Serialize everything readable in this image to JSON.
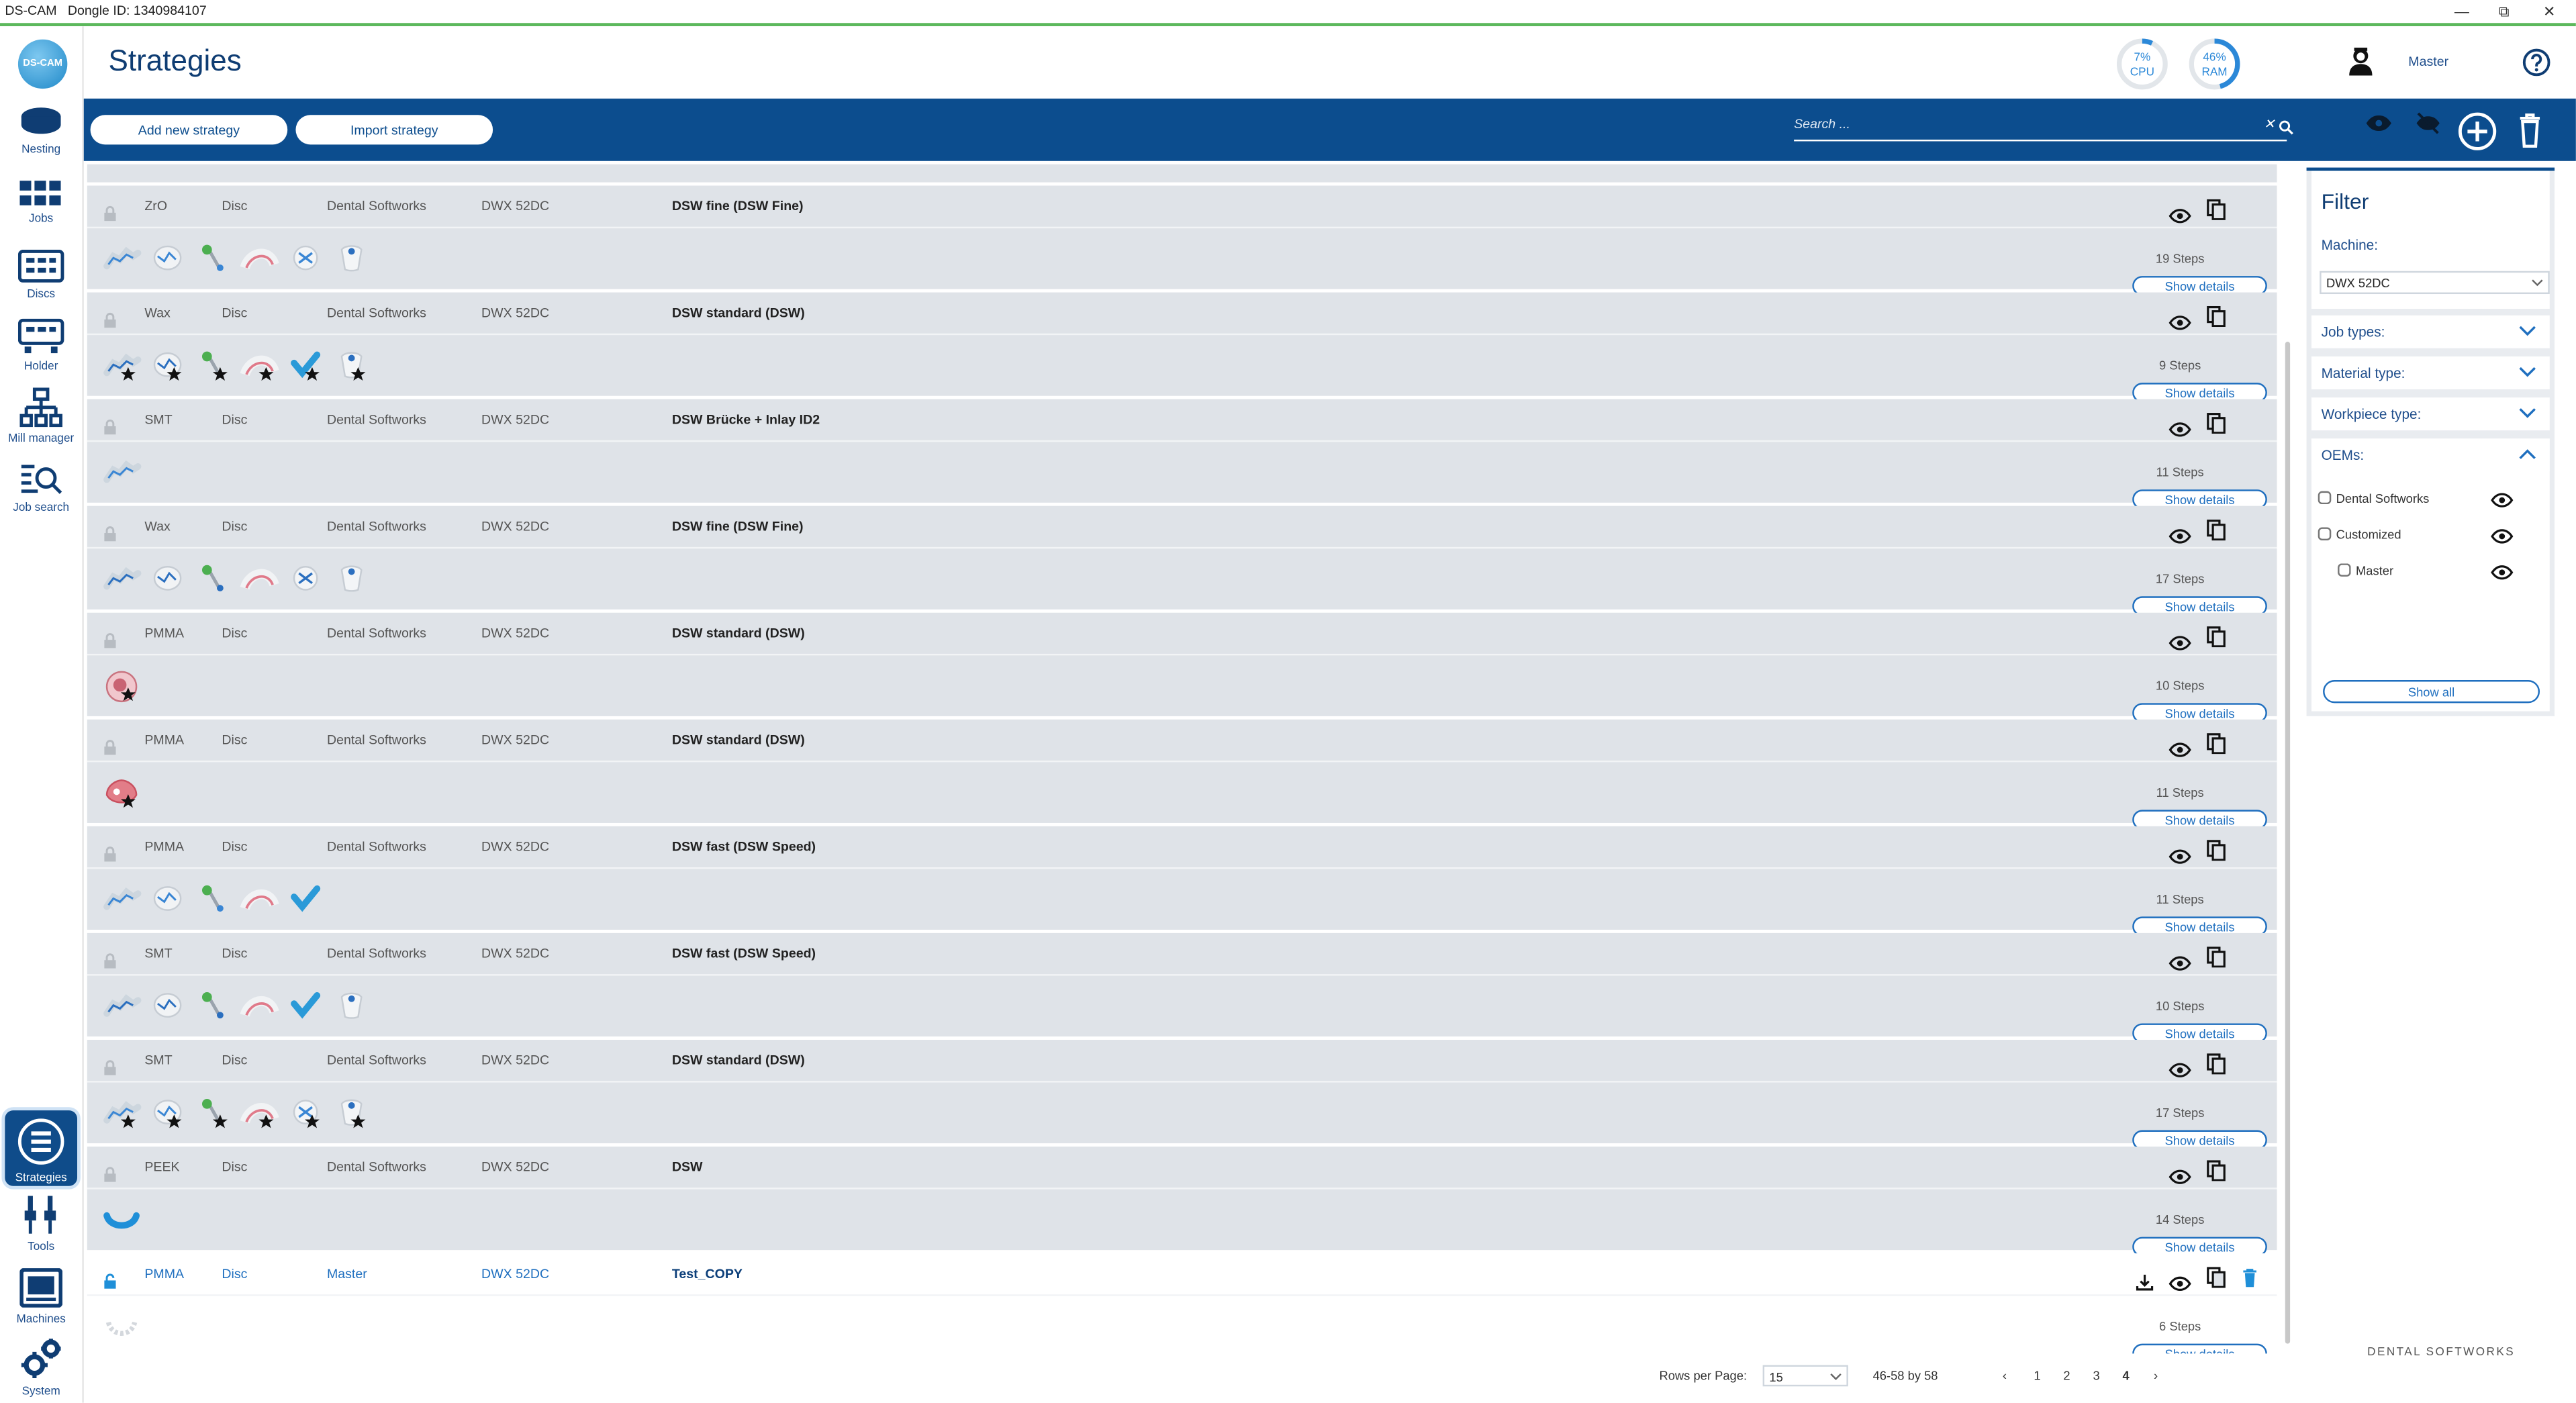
{
  "titlebar": {
    "app": "DS-CAM",
    "dongle": "Dongle ID: 1340984107"
  },
  "header": {
    "title": "Strategies",
    "cpu": {
      "value": "7%",
      "label": "CPU",
      "percent": 7
    },
    "ram": {
      "value": "46%",
      "label": "RAM",
      "percent": 46
    },
    "user": "Master"
  },
  "logo_text": "DS-CAM",
  "sidebar": [
    {
      "label": "Nesting",
      "icon": "nesting-icon"
    },
    {
      "label": "Jobs",
      "icon": "jobs-icon"
    },
    {
      "label": "Discs",
      "icon": "discs-icon"
    },
    {
      "label": "Holder",
      "icon": "holder-icon"
    },
    {
      "label": "Mill manager",
      "icon": "mill-manager-icon"
    },
    {
      "label": "Job search",
      "icon": "job-search-icon"
    },
    {
      "label": "Strategies",
      "icon": "strategies-icon",
      "active": true
    },
    {
      "label": "Tools",
      "icon": "tools-icon"
    },
    {
      "label": "Machines",
      "icon": "machines-icon"
    },
    {
      "label": "System",
      "icon": "system-icon"
    }
  ],
  "toolbar": {
    "add_label": "Add new strategy",
    "import_label": "Import strategy",
    "search_placeholder": "Search ...",
    "accent": "#0c4d8e"
  },
  "rows": [
    {
      "material": "ZrO",
      "type": "Disc",
      "oem": "Dental Softworks",
      "machine": "DWX 52DC",
      "name": "DSW fine (DSW Fine)",
      "steps": "19 Steps",
      "icons": 6,
      "starred": false
    },
    {
      "material": "Wax",
      "type": "Disc",
      "oem": "Dental Softworks",
      "machine": "DWX 52DC",
      "name": "DSW standard (DSW)",
      "steps": "9 Steps",
      "icons": 6,
      "starred": true
    },
    {
      "material": "SMT",
      "type": "Disc",
      "oem": "Dental Softworks",
      "machine": "DWX 52DC",
      "name": "DSW Brücke + Inlay ID2",
      "steps": "11 Steps",
      "icons": 1,
      "starred": false
    },
    {
      "material": "Wax",
      "type": "Disc",
      "oem": "Dental Softworks",
      "machine": "DWX 52DC",
      "name": "DSW fine (DSW Fine)",
      "steps": "17 Steps",
      "icons": 6,
      "starred": false
    },
    {
      "material": "PMMA",
      "type": "Disc",
      "oem": "Dental Softworks",
      "machine": "DWX 52DC",
      "name": "DSW standard (DSW)",
      "steps": "10 Steps",
      "icons": 1,
      "starred": true
    },
    {
      "material": "PMMA",
      "type": "Disc",
      "oem": "Dental Softworks",
      "machine": "DWX 52DC",
      "name": "DSW standard (DSW)",
      "steps": "11 Steps",
      "icons": 1,
      "starred": true
    },
    {
      "material": "PMMA",
      "type": "Disc",
      "oem": "Dental Softworks",
      "machine": "DWX 52DC",
      "name": "DSW fast (DSW Speed)",
      "steps": "11 Steps",
      "icons": 5,
      "starred": false
    },
    {
      "material": "SMT",
      "type": "Disc",
      "oem": "Dental Softworks",
      "machine": "DWX 52DC",
      "name": "DSW fast (DSW Speed)",
      "steps": "10 Steps",
      "icons": 6,
      "starred": false
    },
    {
      "material": "SMT",
      "type": "Disc",
      "oem": "Dental Softworks",
      "machine": "DWX 52DC",
      "name": "DSW standard (DSW)",
      "steps": "17 Steps",
      "icons": 6,
      "starred": true
    },
    {
      "material": "PEEK",
      "type": "Disc",
      "oem": "Dental Softworks",
      "machine": "DWX 52DC",
      "name": "DSW",
      "steps": "14 Steps",
      "icons": 1,
      "starred": false
    },
    {
      "material": "PMMA",
      "type": "Disc",
      "oem": "Master",
      "machine": "DWX 52DC",
      "name": "Test_COPY",
      "steps": "6 Steps",
      "icons": 1,
      "starred": false,
      "editable": true
    }
  ],
  "show_details_label": "Show details",
  "filter": {
    "title": "Filter",
    "machine_label": "Machine:",
    "machine_value": "DWX 52DC",
    "sections": [
      "Job types:",
      "Material type:",
      "Workpiece type:",
      "OEMs:"
    ],
    "oems": [
      "Dental Softworks",
      "Customized",
      "Master"
    ],
    "show_all": "Show all"
  },
  "brand": "DENTAL SOFTWORKS",
  "pagination": {
    "rows_label": "Rows per Page:",
    "rows_value": "15",
    "range": "46-58 by 58",
    "pages": [
      "1",
      "2",
      "3",
      "4"
    ],
    "current": "4"
  }
}
